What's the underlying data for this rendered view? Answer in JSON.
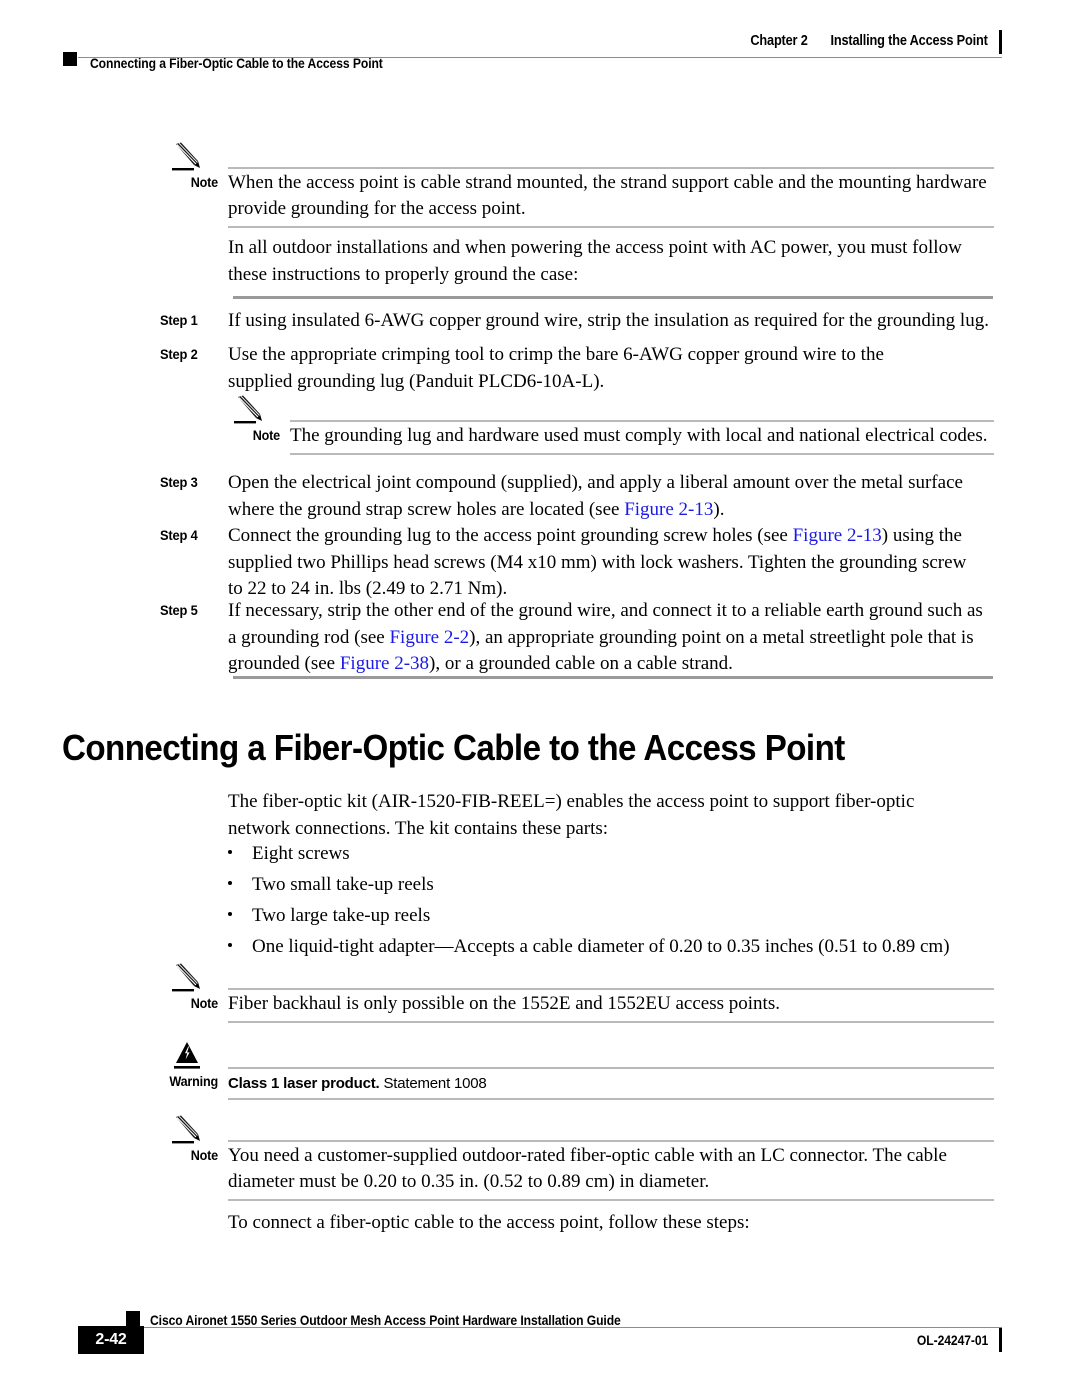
{
  "header": {
    "chapter_label": "Chapter 2",
    "chapter_title": "Installing the Access Point",
    "section_title": "Connecting a Fiber-Optic Cable to the Access Point"
  },
  "note_1": {
    "label": "Note",
    "text": "When the access point is cable strand mounted, the strand support cable and the mounting hardware provide grounding for the access point."
  },
  "intro_paragraph": "In all outdoor installations and when powering the access point with AC power, you must follow these instructions to properly ground the case:",
  "steps": [
    {
      "label": "Step 1",
      "text": "If using insulated 6-AWG copper ground wire, strip the insulation as required for the grounding lug."
    },
    {
      "label": "Step 2",
      "text": "Use the appropriate crimping tool to crimp the bare 6-AWG copper ground wire to the supplied grounding lug (Panduit PLCD6-10A-L)."
    },
    {
      "label": "Step 3",
      "text_before": "Open the electrical joint compound (supplied), and apply a liberal amount over the metal surface where the ground strap screw holes are located (see ",
      "link": "Figure 2-13",
      "text_after": ")."
    },
    {
      "label": "Step 4",
      "text_before": "Connect the grounding lug to the access point grounding screw holes (see ",
      "link": "Figure 2-13",
      "text_after": ") using the supplied two Phillips head screws (M4 x10 mm) with lock washers. Tighten the grounding screw to 22 to 24 in. lbs (2.49 to 2.71 Nm)."
    },
    {
      "label": "Step 5",
      "text_before": "If necessary, strip the other end of the ground wire, and connect it to a reliable earth ground such as a grounding rod (see ",
      "link_1": "Figure 2-2",
      "text_middle": "), an appropriate grounding point on a metal streetlight pole that is grounded (see ",
      "link_2": "Figure 2-38",
      "text_after": "), or a grounded cable on a cable strand."
    }
  ],
  "note_2": {
    "label": "Note",
    "text": "The grounding lug and hardware used must comply with local and national electrical codes."
  },
  "section": {
    "title": "Connecting a Fiber-Optic Cable to the Access Point",
    "intro": "The fiber-optic kit (AIR-1520-FIB-REEL=) enables the access point to support fiber-optic network connections. The kit contains these parts:",
    "bullets": [
      "Eight screws",
      "Two small take-up reels",
      "Two large take-up reels",
      "One liquid-tight adapter—Accepts a cable diameter of 0.20 to 0.35 inches (0.51 to 0.89 cm)"
    ]
  },
  "note_3": {
    "label": "Note",
    "text": "Fiber backhaul is only possible on the 1552E and 1552EU access points."
  },
  "warning": {
    "label": "Warning",
    "bold_text": "Class 1 laser product.",
    "rest_text": " Statement 1008"
  },
  "note_4": {
    "label": "Note",
    "line1": "You need a customer-supplied outdoor-rated fiber-optic cable with an LC connector. The cable diameter",
    "line2": "must be 0.20 to 0.35 in. (0.52 to 0.89 cm) in diameter."
  },
  "closing_paragraph": "To connect a fiber-optic cable to the access point, follow these steps:",
  "footer": {
    "page_number": "2-42",
    "guide_title": "Cisco Aironet 1550 Series Outdoor Mesh Access Point Hardware Installation Guide",
    "doc_number": "OL-24247-01"
  },
  "colors": {
    "link": "#1a1ae6",
    "rule_light": "#b9b9b9",
    "rule_thick": "#9a9a9a"
  }
}
